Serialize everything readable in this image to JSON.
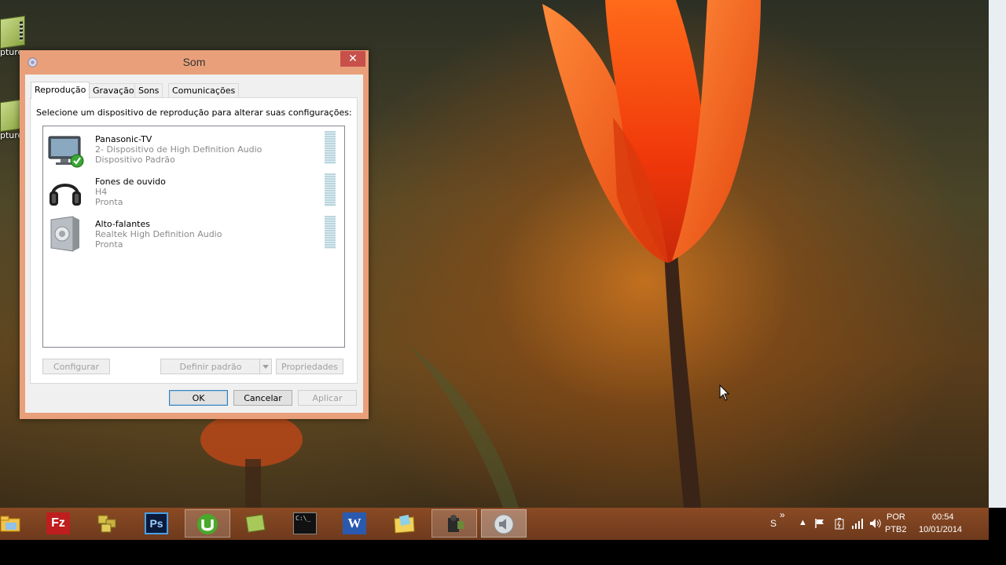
{
  "desktop": {
    "icons": [
      {
        "label": "pture"
      },
      {
        "label": "pture"
      }
    ]
  },
  "dialog": {
    "title": "Som",
    "close_glyph": "✕",
    "tabs": [
      {
        "label": "Reprodução",
        "active": true
      },
      {
        "label": "Gravação",
        "active": false
      },
      {
        "label": "Sons",
        "active": false
      },
      {
        "label": "Comunicações",
        "active": false
      }
    ],
    "instruction": "Selecione um dispositivo de reprodução para alterar suas configurações:",
    "devices": [
      {
        "name": "Panasonic-TV",
        "description": "2- Dispositivo de High Definition Audio",
        "status": "Dispositivo Padrão",
        "icon": "tv-monitor-icon",
        "default_check": true
      },
      {
        "name": "Fones de ouvido",
        "description": "H4",
        "status": "Pronta",
        "icon": "headphones-icon"
      },
      {
        "name": "Alto-falantes",
        "description": "Realtek High Definition Audio",
        "status": "Pronta",
        "icon": "speaker-icon"
      }
    ],
    "buttons": {
      "configure": "Configurar",
      "set_default": "Definir padrão",
      "properties": "Propriedades",
      "ok": "OK",
      "cancel": "Cancelar",
      "apply": "Aplicar"
    }
  },
  "taskbar": {
    "items": [
      {
        "icon": "file-explorer-icon"
      },
      {
        "icon": "filezilla-icon",
        "text": "Fz"
      },
      {
        "icon": "app-stack-icon"
      },
      {
        "icon": "photoshop-icon",
        "text": "Ps"
      },
      {
        "icon": "utorrent-icon",
        "running": true
      },
      {
        "icon": "notes-icon"
      },
      {
        "icon": "command-prompt-icon",
        "text": "C:\\_"
      },
      {
        "icon": "word-icon",
        "text": "W"
      },
      {
        "icon": "folder-icon"
      },
      {
        "icon": "camcorder-icon",
        "running": true
      },
      {
        "icon": "sound-icon",
        "running": true
      }
    ],
    "tray": {
      "s_label": "S",
      "overflow": "»",
      "language": "POR",
      "layout": "PTB2",
      "time": "00:54",
      "date": "10/01/2014"
    }
  },
  "colors": {
    "window_frame": "#e9a07a",
    "close_button": "#c7504b",
    "taskbar": "#7a4220"
  }
}
